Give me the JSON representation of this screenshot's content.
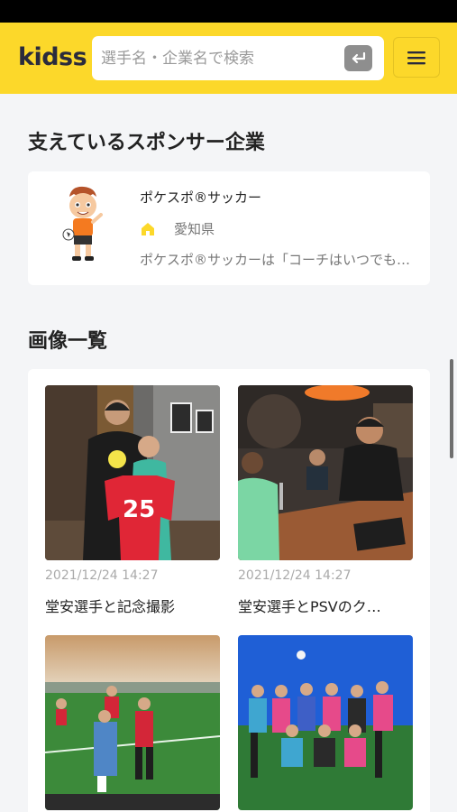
{
  "header": {
    "logo": "kidss",
    "search_placeholder": "選手名・企業名で検索"
  },
  "sponsors": {
    "title": "支えているスポンサー企業",
    "card": {
      "name": "ポケスポ®サッカー",
      "prefecture": "愛知県",
      "description": "ポケスポ®サッカーは「コーチはいつでも…"
    }
  },
  "images": {
    "title": "画像一覧",
    "items": [
      {
        "date": "2021/12/24 14:27",
        "caption": "堂安選手と記念撮影"
      },
      {
        "date": "2021/12/24 14:27",
        "caption": "堂安選手とPSVのク…"
      },
      {
        "date": "",
        "caption": ""
      },
      {
        "date": "",
        "caption": ""
      }
    ]
  },
  "colors": {
    "brand_yellow": "#fcd82a",
    "logo_navy": "#2a2b3c"
  }
}
